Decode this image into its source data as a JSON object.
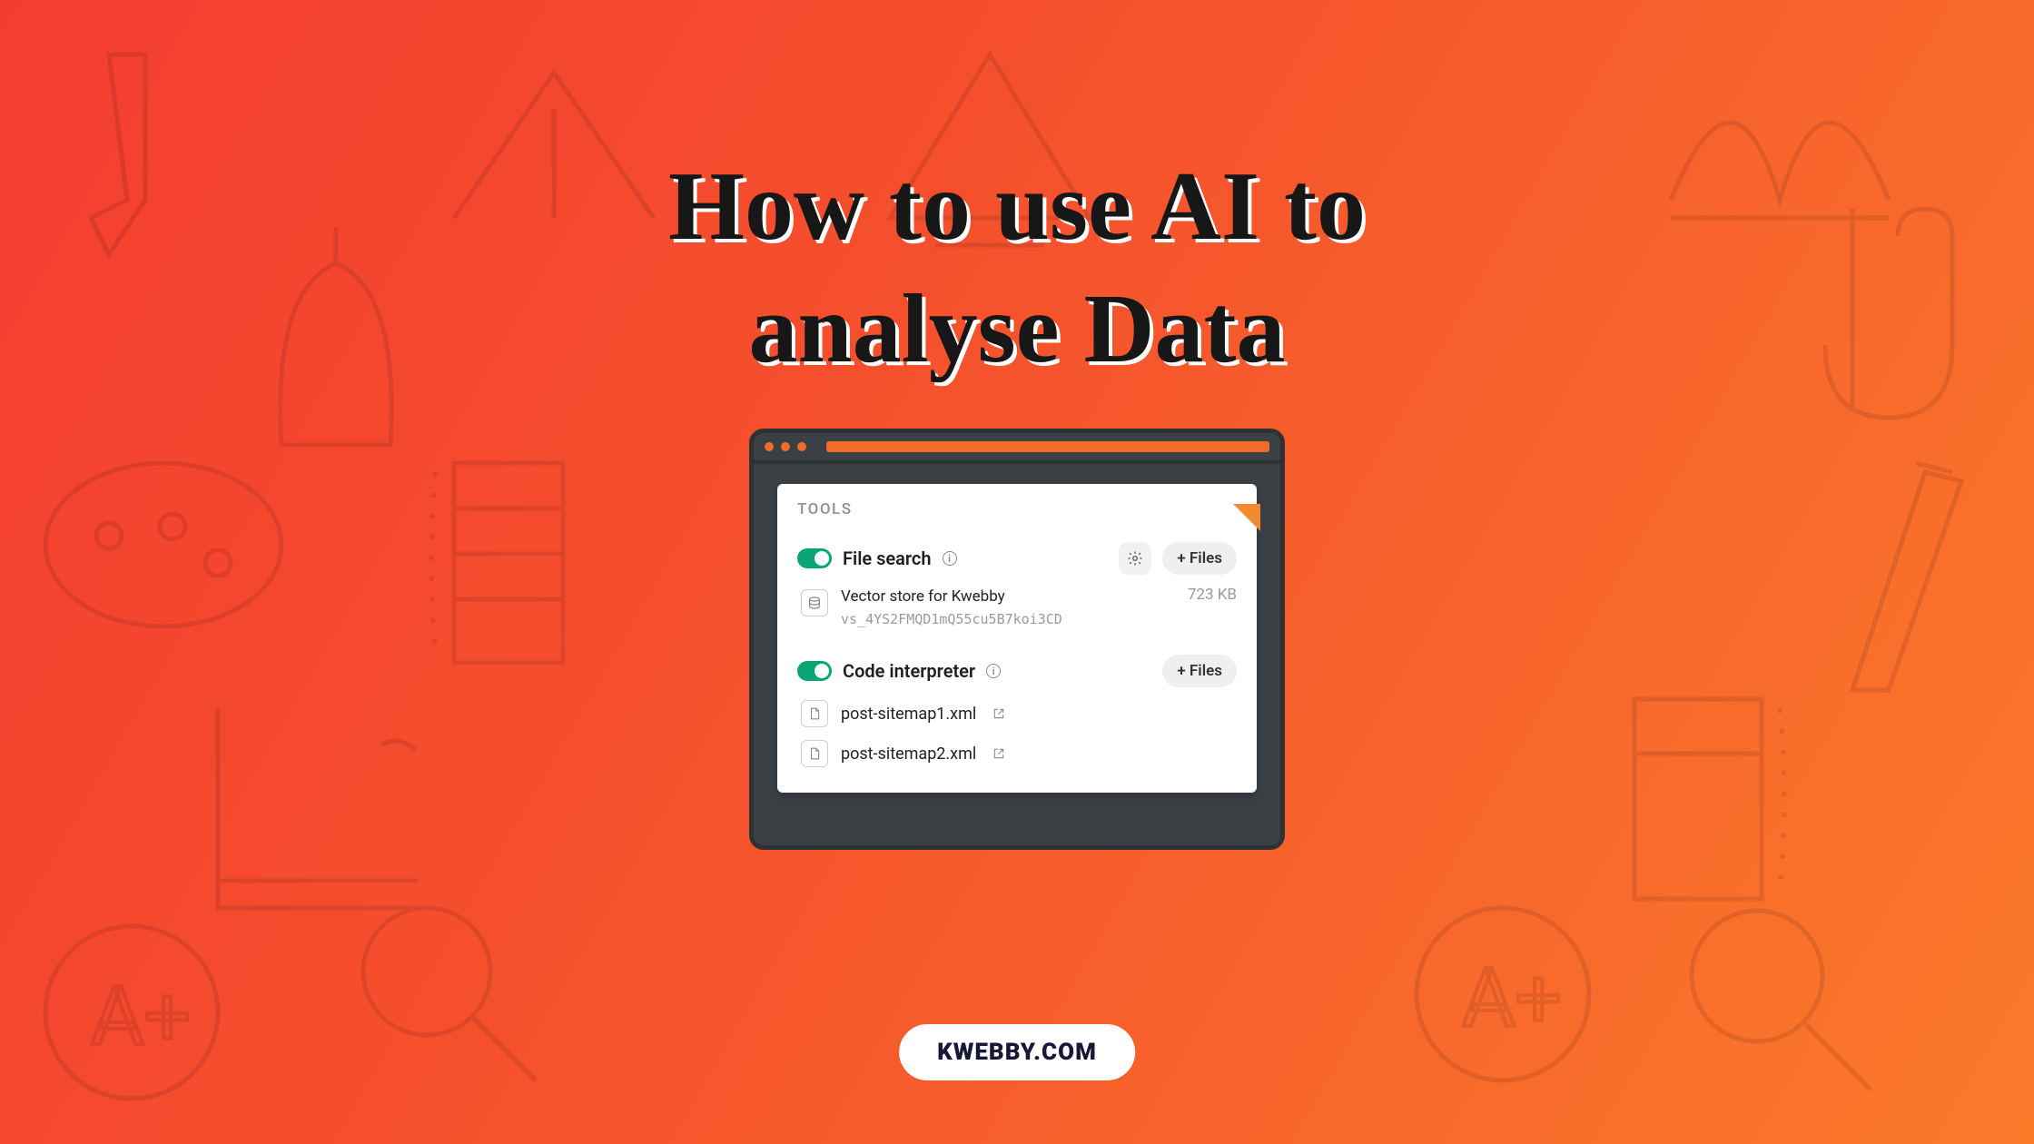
{
  "title_line1": "How to use AI to",
  "title_line2": "analyse Data",
  "panel": {
    "header": "TOOLS",
    "file_search": {
      "label": "File search",
      "settings_visible": true,
      "files_button": "+ Files",
      "store_name": "Vector store for Kwebby",
      "store_id": "vs_4YS2FMQD1mQ55cu5B7koi3CD",
      "size": "723 KB"
    },
    "code_interpreter": {
      "label": "Code interpreter",
      "files_button": "+ Files",
      "files": [
        {
          "name": "post-sitemap1.xml"
        },
        {
          "name": "post-sitemap2.xml"
        }
      ]
    }
  },
  "brand": "KWEBBY.COM"
}
